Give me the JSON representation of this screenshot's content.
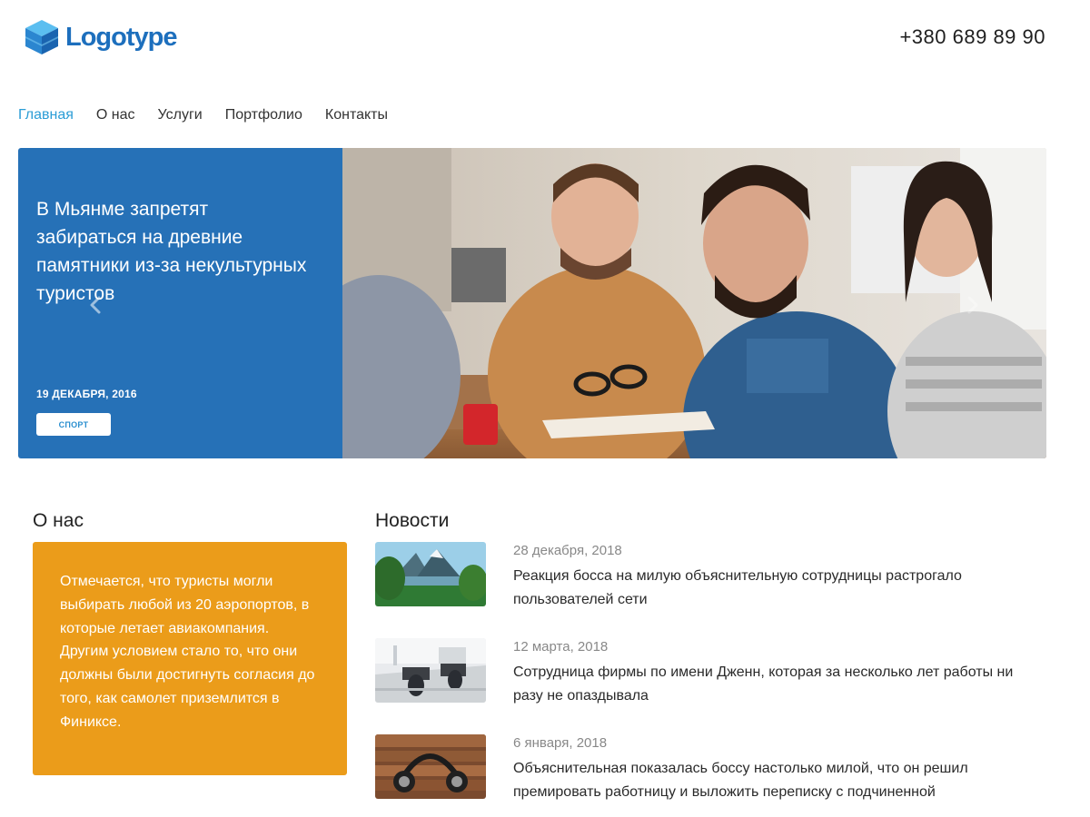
{
  "header": {
    "logo_text": "Logotype",
    "phone": "+380 689 89 90"
  },
  "nav": {
    "items": [
      {
        "label": "Главная",
        "active": true
      },
      {
        "label": "О нас",
        "active": false
      },
      {
        "label": "Услуги",
        "active": false
      },
      {
        "label": "Портфолио",
        "active": false
      },
      {
        "label": "Контакты",
        "active": false
      }
    ]
  },
  "hero": {
    "title": "В Мьянме запретят забираться на древние памятники из-за некультурных туристов",
    "date": "19 ДЕКАБРЯ, 2016",
    "tag": "СПОРТ",
    "prev_icon": "chevron-left-icon",
    "next_icon": "chevron-right-icon"
  },
  "about": {
    "heading": "О нас",
    "text": "Отмечается, что туристы могли выбирать любой из 20 аэропортов, в которые летает авиакомпания. Другим условием стало то, что они должны были достигнуть согласия до того, как самолет приземлится в Финиксе."
  },
  "news": {
    "heading": "Новости",
    "items": [
      {
        "date": "28 декабря, 2018",
        "title": "Реакция босса на милую объяснительную сотрудницы растрогало пользователей сети"
      },
      {
        "date": "12 марта, 2018",
        "title": "Сотрудница фирмы по имени Дженн, которая за несколько лет работы ни разу не опаздывала"
      },
      {
        "date": "6 января, 2018",
        "title": "Объяснительная показалась боссу настолько милой, что он решил премировать работницу и выложить переписку с подчиненной"
      }
    ]
  },
  "colors": {
    "brand_blue": "#1d6fbd",
    "hero_panel": "#2671b7",
    "nav_active": "#2b9dd6",
    "about_box": "#eb9c1a"
  }
}
